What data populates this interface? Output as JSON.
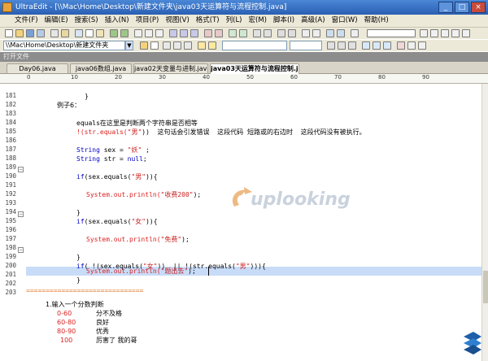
{
  "window": {
    "title": "UltraEdit - [\\\\Mac\\Home\\Desktop\\新建文件夹\\java03天运算符与流程控制.java]",
    "buttons": {
      "minimize": "_",
      "maximize": "□",
      "close": "×"
    }
  },
  "menu": [
    "文件(F)",
    "编辑(E)",
    "搜索(S)",
    "插入(N)",
    "项目(P)",
    "视图(V)",
    "格式(T)",
    "列(L)",
    "宏(M)",
    "脚本(I)",
    "高级(A)",
    "窗口(W)",
    "帮助(H)"
  ],
  "path_combo": "\\\\Mac\\Home\\Desktop\\新建文件夹",
  "open_files_pane": "打开文件",
  "tabs": [
    {
      "label": "Day06.java",
      "active": false
    },
    {
      "label": "java06数组.java",
      "active": false
    },
    {
      "label": "java02天变量与进制.java",
      "active": false
    },
    {
      "label": "java03天运算符与流程控制.java",
      "active": true
    }
  ],
  "ruler": [
    "0",
    "10",
    "20",
    "30",
    "40",
    "50",
    "60",
    "70",
    "80",
    "90"
  ],
  "line_numbers": [
    "181",
    "182",
    "183",
    "184",
    "185",
    "186",
    "187",
    "188",
    "189",
    "190",
    "191",
    "192",
    "193",
    "194",
    "195",
    "196",
    "197",
    "198",
    "199",
    "200",
    "201",
    "202",
    "203"
  ],
  "code": {
    "l181": "}",
    "l182": "例子6：",
    "l184_a": "equals",
    "l184_b": "在这里是判断两个字符串是否相等",
    "l185_a": "!(str.equals(",
    "l185_b": "\"男\"",
    "l185_c": "))  这句话会引发错误  这段代码 短路或的右边时  这段代码没有被执行。",
    "l187_kw": "String",
    "l187_mid": " sex = ",
    "l187_str": "\"妖\"",
    "l187_end": " ;",
    "l188_kw": "String",
    "l188_mid": " str = ",
    "l188_null": "null",
    "l188_end": ";",
    "l190_kw": "if",
    "l190_a": "(sex.equals(",
    "l190_str": "\"男\"",
    "l190_b": ")){",
    "l192_a": "System.out.println(",
    "l192_str": "\"收费200\"",
    "l192_b": ");",
    "l194": "}",
    "l195_kw": "if",
    "l195_a": "(sex.equals(",
    "l195_str": "\"女\"",
    "l195_b": ")){",
    "l197_a": "System.out.println(",
    "l197_str": "\"免费\"",
    "l197_b": ");",
    "l199": "}",
    "l200_kw": "if",
    "l200_a": "( !(sex.equals(",
    "l200_str1": "\"女\"",
    "l200_b": "))  || !(str.equals(",
    "l200_str2": "\"男\"",
    "l200_c": "))){",
    "l202_a": "System.out.println(",
    "l202_str": "\"题出去\"",
    "l202_b": ");",
    "l203": "}"
  },
  "separator": "==============================",
  "notes": {
    "title": "1.输入一个分数判断",
    "rows": [
      {
        "range": "0-60",
        "label": "分不及格"
      },
      {
        "range": "60-80",
        "label": "良好"
      },
      {
        "range": "80-90",
        "label": "优秀"
      },
      {
        "range": "100",
        "label": "厉害了 我的哥"
      }
    ]
  },
  "watermark_text": "uplooking",
  "colors": {
    "keyword": "#0000c8",
    "string": "#c81e1e",
    "highlight": "#c8dcf8",
    "separator": "#e07020"
  }
}
